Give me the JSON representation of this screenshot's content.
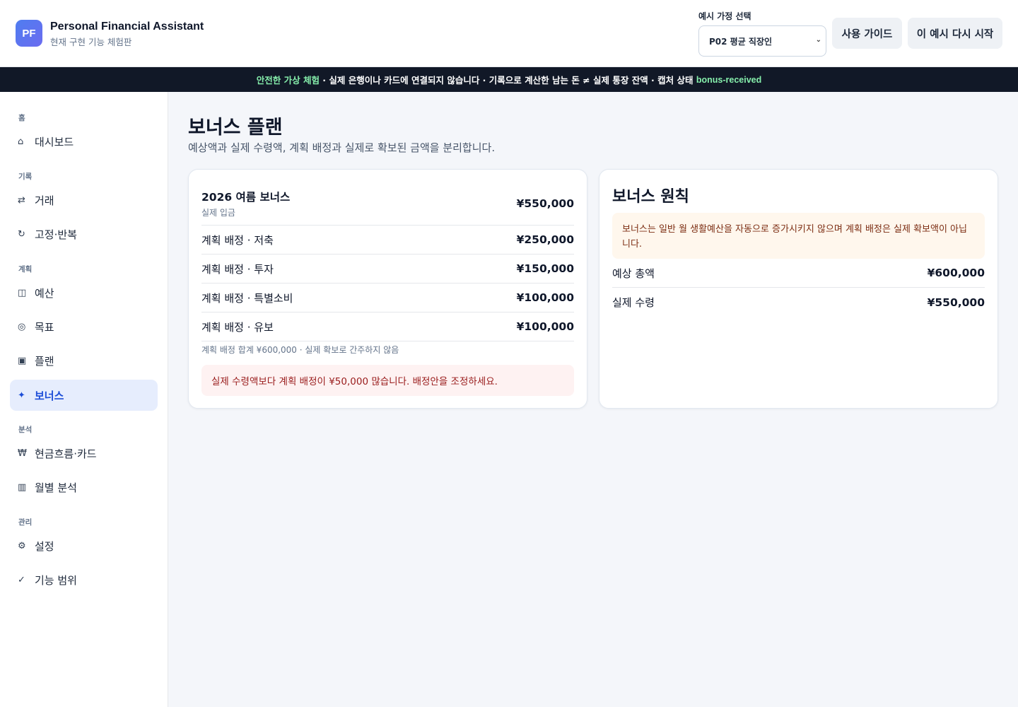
{
  "header": {
    "logo_text": "PF",
    "app_title": "Personal Financial Assistant",
    "app_subtitle": "현재 구현 기능 체험판",
    "select_label": "예시 가정 선택",
    "select_value": "P02 평균 직장인",
    "guide_button": "사용 가이드",
    "restart_button": "이 예시 다시 시작"
  },
  "banner": {
    "highlight": "안전한 가상 체험",
    "text": " · 실제 은행이나 카드에 연결되지 않습니다 · 기록으로 계산한 남는 돈 ≠ 실제 통장 잔액 · 캡처 상태 ",
    "state": "bonus-received"
  },
  "sidebar": {
    "sections": {
      "home": "홈",
      "records": "기록",
      "planning": "계획",
      "analysis": "분석",
      "manage": "관리"
    },
    "items": [
      {
        "icon": "⌂",
        "label": "대시보드"
      },
      {
        "icon": "⇄",
        "label": "거래"
      },
      {
        "icon": "↻",
        "label": "고정·반복"
      },
      {
        "icon": "◫",
        "label": "예산"
      },
      {
        "icon": "◎",
        "label": "목표"
      },
      {
        "icon": "▣",
        "label": "플랜"
      },
      {
        "icon": "✦",
        "label": "보너스"
      },
      {
        "icon": "₩",
        "label": "현금흐름·카드"
      },
      {
        "icon": "▥",
        "label": "월별 분석"
      },
      {
        "icon": "⚙",
        "label": "설정"
      },
      {
        "icon": "✓",
        "label": "기능 범위"
      }
    ]
  },
  "main": {
    "title": "보너스 플랜",
    "description": "예상액과 실제 수령액, 계획 배정과 실제로 확보된 금액을 분리합니다.",
    "bonus_card": {
      "name": "2026 여름 보너스",
      "status": "실제 입금",
      "amount": "¥550,000",
      "allocations": [
        {
          "label": "계획 배정 · 저축",
          "amount": "¥250,000"
        },
        {
          "label": "계획 배정 · 투자",
          "amount": "¥150,000"
        },
        {
          "label": "계획 배정 · 특별소비",
          "amount": "¥100,000"
        },
        {
          "label": "계획 배정 · 유보",
          "amount": "¥100,000"
        }
      ],
      "sum_note": "계획 배정 합계 ¥600,000 · 실제 확보로 간주하지 않음",
      "warning": "실제 수령액보다 계획 배정이 ¥50,000 많습니다. 배정안을 조정하세요."
    },
    "principles_card": {
      "title": "보너스 원칙",
      "notice": "보너스는 일반 월 생활예산을 자동으로 증가시키지 않으며 계획 배정은 실제 확보액이 아닙니다.",
      "expected_label": "예상 총액",
      "expected_value": "¥600,000",
      "actual_label": "실제 수령",
      "actual_value": "¥550,000"
    }
  }
}
